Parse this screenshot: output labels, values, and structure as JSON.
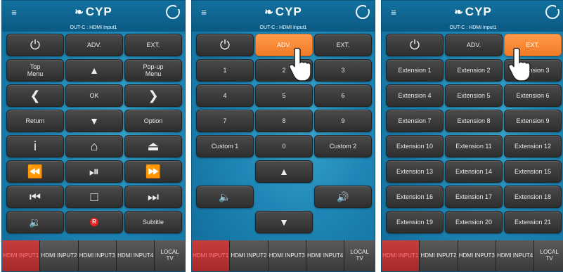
{
  "header": {
    "brand": "CYP"
  },
  "status": "OUT-C : HDMI Input1",
  "panel1": {
    "rows": [
      [
        "",
        "ADV.",
        "EXT."
      ],
      [
        "Top\nMenu",
        "",
        "Pop-up\nMenu"
      ],
      [
        "",
        "OK",
        ""
      ],
      [
        "Return",
        "",
        "Option"
      ],
      [
        "",
        "",
        ""
      ],
      [
        "",
        "",
        ""
      ],
      [
        "",
        "",
        ""
      ],
      [
        "",
        "R",
        "Subtitle"
      ]
    ]
  },
  "panel2": {
    "adv": "ADV.",
    "ext": "EXT.",
    "digits": [
      "1",
      "2",
      "3",
      "4",
      "5",
      "6",
      "7",
      "8",
      "9"
    ],
    "custom1": "Custom 1",
    "zero": "0",
    "custom2": "Custom 2"
  },
  "panel3": {
    "adv": "ADV.",
    "ext": "EXT.",
    "extensions": [
      "Extension 1",
      "Extension 2",
      "Extension 3",
      "Extension 4",
      "Extension 5",
      "Extension 6",
      "Extension 7",
      "Extension 8",
      "Extension 9",
      "Extension 10",
      "Extension 11",
      "Extension 12",
      "Extension 13",
      "Extension 14",
      "Extension 15",
      "Extension 16",
      "Extension 17",
      "Extension 18",
      "Extension 19",
      "Extension 20",
      "Extension 21"
    ]
  },
  "tabs": [
    "HDMI INPUT1",
    "HDMI INPUT2",
    "HDMI INPUT3",
    "HDMI INPUT4",
    "LOCAL\nTV"
  ],
  "colors": {
    "accent": "#f07a26",
    "active_tab": "#a62a2a",
    "background": "#1e86b6"
  }
}
